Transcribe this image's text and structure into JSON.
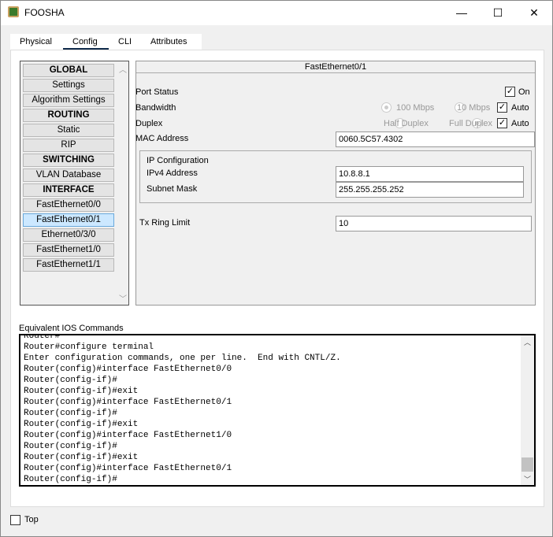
{
  "window": {
    "title": "FOOSHA",
    "minimize": "—",
    "maximize": "☐",
    "close": "✕"
  },
  "tabs": [
    {
      "label": "Physical"
    },
    {
      "label": "Config",
      "active": true
    },
    {
      "label": "CLI"
    },
    {
      "label": "Attributes"
    }
  ],
  "accent": "#0f2a4a",
  "sidebar": {
    "items": [
      {
        "label": "GLOBAL",
        "header": true
      },
      {
        "label": "Settings"
      },
      {
        "label": "Algorithm Settings"
      },
      {
        "label": "ROUTING",
        "header": true
      },
      {
        "label": "Static"
      },
      {
        "label": "RIP"
      },
      {
        "label": "SWITCHING",
        "header": true
      },
      {
        "label": "VLAN Database"
      },
      {
        "label": "INTERFACE",
        "header": true
      },
      {
        "label": "FastEthernet0/0"
      },
      {
        "label": "FastEthernet0/1",
        "selected": true
      },
      {
        "label": "Ethernet0/3/0"
      },
      {
        "label": "FastEthernet1/0"
      },
      {
        "label": "FastEthernet1/1"
      }
    ]
  },
  "interface": {
    "title": "FastEthernet0/1",
    "port_status_label": "Port Status",
    "port_status_on": "On",
    "port_on_checked": true,
    "bandwidth_label": "Bandwidth",
    "bw_100": "100 Mbps",
    "bw_10": "10 Mbps",
    "bw_selected": "100 Mbps",
    "bw_auto": "Auto",
    "bw_auto_checked": true,
    "duplex_label": "Duplex",
    "dup_half": "Half Duplex",
    "dup_full": "Full Duplex",
    "dup_selected": "Full Duplex",
    "dup_auto": "Auto",
    "dup_auto_checked": true,
    "mac_label": "MAC Address",
    "mac_value": "0060.5C57.4302",
    "ip_config_label": "IP Configuration",
    "ipv4_label": "IPv4 Address",
    "ipv4_value": "10.8.8.1",
    "mask_label": "Subnet Mask",
    "mask_value": "255.255.255.252",
    "tx_label": "Tx Ring Limit",
    "tx_value": "10"
  },
  "ios": {
    "label": "Equivalent IOS Commands",
    "lines": [
      "Router#",
      "Router#configure terminal",
      "Enter configuration commands, one per line.  End with CNTL/Z.",
      "Router(config)#interface FastEthernet0/0",
      "Router(config-if)#",
      "Router(config-if)#exit",
      "Router(config)#interface FastEthernet0/1",
      "Router(config-if)#",
      "Router(config-if)#exit",
      "Router(config)#interface FastEthernet1/0",
      "Router(config-if)#",
      "Router(config-if)#exit",
      "Router(config)#interface FastEthernet0/1",
      "Router(config-if)#"
    ]
  },
  "footer": {
    "top_label": "Top",
    "top_checked": false
  }
}
